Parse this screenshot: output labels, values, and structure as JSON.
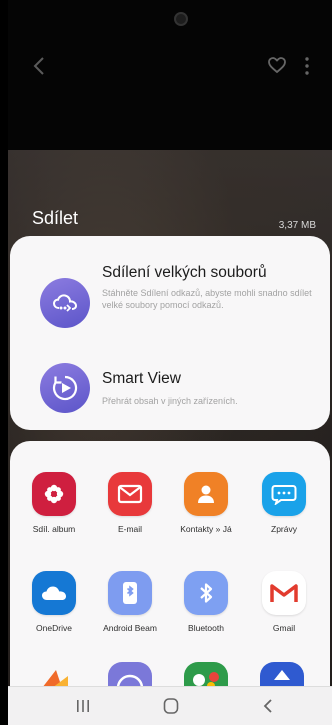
{
  "header": {
    "title": "Sdílet",
    "file_size": "3,37 MB"
  },
  "top_options": [
    {
      "title": "Sdílení velkých souborů",
      "description": "Stáhněte Sdílení odkazů, abyste mohli snadno sdílet velké soubory pomocí odkazů.",
      "icon": "cloud-link-icon"
    },
    {
      "title": "Smart View",
      "description": "Přehrát obsah v jiných zařízeních.",
      "icon": "smart-view-icon"
    }
  ],
  "apps": [
    {
      "label": "Sdíl. album",
      "icon": "shared-album-icon",
      "color": "#cf1f3f"
    },
    {
      "label": "E-mail",
      "icon": "email-icon",
      "color": "#e8393b"
    },
    {
      "label": "Kontakty » Já",
      "icon": "contacts-icon",
      "color": "#f08126"
    },
    {
      "label": "Zprávy",
      "icon": "messages-icon",
      "color": "#1aa2e9"
    },
    {
      "label": "OneDrive",
      "icon": "onedrive-icon",
      "color": "#1578d4"
    },
    {
      "label": "Android Beam",
      "icon": "android-beam-icon",
      "color": "#7e9cf0"
    },
    {
      "label": "Bluetooth",
      "icon": "bluetooth-icon",
      "color": "#7ea0f2"
    },
    {
      "label": "Gmail",
      "icon": "gmail-icon",
      "color": "#ffffff"
    }
  ],
  "navigation": {
    "recent": "recent-apps-icon",
    "home": "home-icon",
    "back": "back-icon"
  }
}
